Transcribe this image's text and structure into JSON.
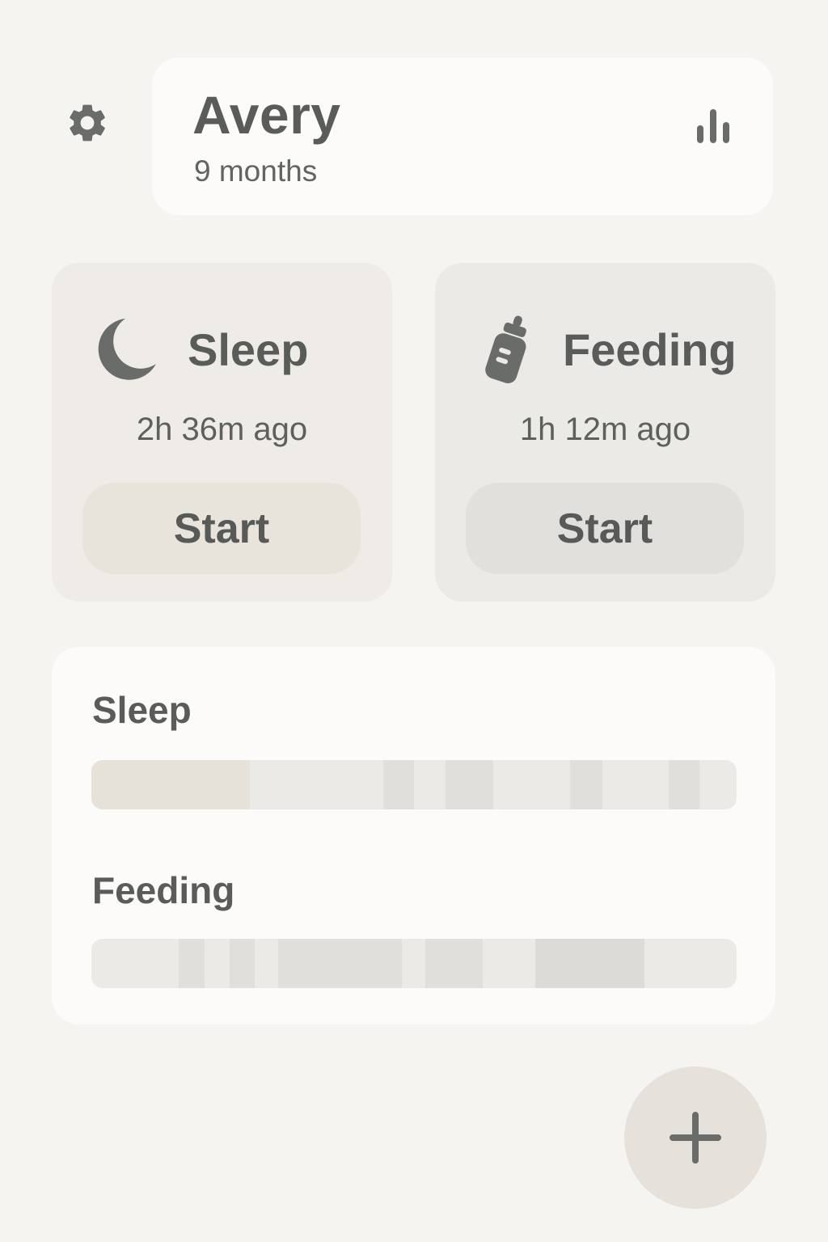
{
  "header": {
    "settings_icon": "gear-icon",
    "stats_icon": "bar-chart-icon",
    "child_name": "Avery",
    "child_age": "9 months"
  },
  "cards": {
    "sleep": {
      "icon": "moon-icon",
      "title": "Sleep",
      "last": "2h 36m ago",
      "button_label": "Start"
    },
    "feeding": {
      "icon": "baby-bottle-icon",
      "title": "Feeding",
      "last": "1h 12m ago",
      "button_label": "Start"
    }
  },
  "timelines": {
    "sleep": {
      "label": "Sleep",
      "segments": [
        {
          "start": 0.0,
          "end": 0.245,
          "color": "#e6e1d9"
        },
        {
          "start": 0.452,
          "end": 0.5,
          "color": "#e0dfdb"
        },
        {
          "start": 0.549,
          "end": 0.623,
          "color": "#e0dfdb"
        },
        {
          "start": 0.742,
          "end": 0.792,
          "color": "#e0dfdb"
        },
        {
          "start": 0.895,
          "end": 0.942,
          "color": "#e0dfdb"
        }
      ]
    },
    "feeding": {
      "label": "Feeding",
      "segments": [
        {
          "start": 0.135,
          "end": 0.176,
          "color": "#e0dfdb"
        },
        {
          "start": 0.214,
          "end": 0.253,
          "color": "#e0dfdb"
        },
        {
          "start": 0.29,
          "end": 0.481,
          "color": "#e0dfdb"
        },
        {
          "start": 0.518,
          "end": 0.607,
          "color": "#e0dfdb"
        },
        {
          "start": 0.688,
          "end": 0.857,
          "color": "#dcdbd7"
        }
      ]
    }
  },
  "fab": {
    "icon": "plus-icon"
  },
  "colors": {
    "background": "#f5f4f1",
    "card_surface": "#fcfbf9",
    "icon": "#6a6c69",
    "text": "#5a5c59",
    "timeline_track": "#ebeae7"
  }
}
